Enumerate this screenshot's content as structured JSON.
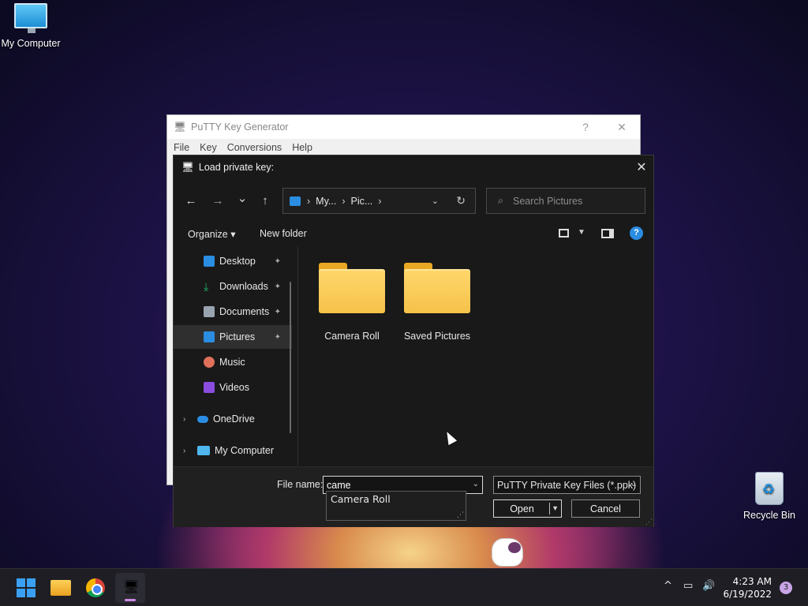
{
  "desktop": {
    "icons": [
      {
        "label": "My Computer"
      },
      {
        "label": "Recycle Bin"
      }
    ]
  },
  "putty_window": {
    "title": "PuTTY Key Generator",
    "help_glyph": "?",
    "close_glyph": "✕",
    "menu": [
      "File",
      "Key",
      "Conversions",
      "Help"
    ]
  },
  "dialog": {
    "title": "Load private key:",
    "close_glyph": "✕",
    "nav": {
      "back": "←",
      "forward": "→",
      "recent": "⌄",
      "up": "↑"
    },
    "address": {
      "crumbs": [
        "My...",
        "Pic..."
      ],
      "sep": "›",
      "dropdown": "⌄",
      "refresh": "↻"
    },
    "search": {
      "placeholder": "Search Pictures",
      "icon": "⌕"
    },
    "toolbar": {
      "organize": "Organize ▾",
      "new_folder": "New folder",
      "help": "?"
    },
    "nav_pane": [
      {
        "label": "Desktop",
        "pinned": true,
        "color": "#2b8de2"
      },
      {
        "label": "Downloads",
        "pinned": true,
        "color": "#27b36b"
      },
      {
        "label": "Documents",
        "pinned": true,
        "color": "#9aa4b0"
      },
      {
        "label": "Pictures",
        "pinned": true,
        "color": "#2b8de2",
        "selected": true
      },
      {
        "label": "Music",
        "pinned": false,
        "color": "#e0705a"
      },
      {
        "label": "Videos",
        "pinned": false,
        "color": "#8a4ddf"
      },
      {
        "label": "OneDrive",
        "expandable": true,
        "color": "#2b8de2"
      },
      {
        "label": "My Computer",
        "expandable": true,
        "color": "#4fb6ee"
      }
    ],
    "pin_glyph": "📌",
    "chevron": "›",
    "folders": [
      {
        "label": "Camera Roll"
      },
      {
        "label": "Saved Pictures"
      }
    ],
    "file_name": {
      "label": "File name:",
      "value": "came",
      "suggestion": "Camera Roll"
    },
    "file_type": {
      "value": "PuTTY Private Key Files (*.ppk)"
    },
    "buttons": {
      "open": "Open",
      "cancel": "Cancel"
    }
  },
  "taskbar": {
    "tray": {
      "chevron": "^",
      "network": "▭",
      "volume": "🔊"
    },
    "clock": {
      "time": "4:23 AM",
      "date": "6/19/2022"
    },
    "notifications": "3"
  }
}
